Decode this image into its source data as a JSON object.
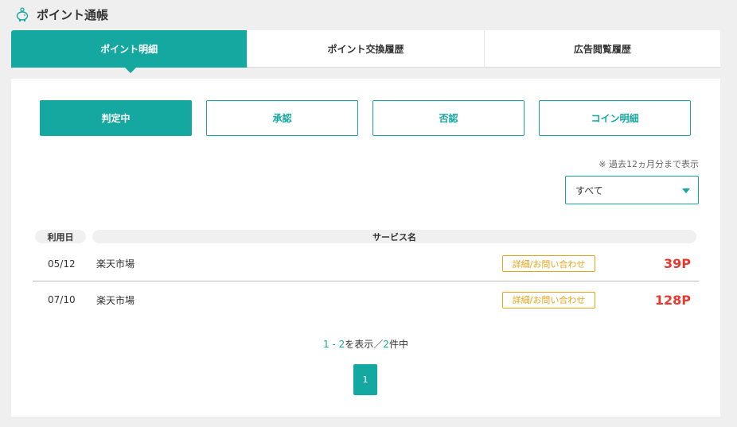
{
  "header": {
    "title": "ポイント通帳",
    "icon": "piggy-bank-icon"
  },
  "main_tabs": [
    {
      "label": "ポイント明細",
      "active": true
    },
    {
      "label": "ポイント交換履歴",
      "active": false
    },
    {
      "label": "広告閲覧履歴",
      "active": false
    }
  ],
  "sub_tabs": [
    {
      "label": "判定中",
      "active": true
    },
    {
      "label": "承認",
      "active": false
    },
    {
      "label": "否認",
      "active": false
    },
    {
      "label": "コイン明細",
      "active": false
    }
  ],
  "note": "※ 過去12ヵ月分まで表示",
  "filter": {
    "selected": "すべて"
  },
  "table": {
    "headers": {
      "date": "利用日",
      "service": "サービス名"
    },
    "rows": [
      {
        "date": "05/12",
        "service": "楽天市場",
        "detail": "詳細/お問い合わせ",
        "points": "39P"
      },
      {
        "date": "07/10",
        "service": "楽天市場",
        "detail": "詳細/お問い合わせ",
        "points": "128P"
      }
    ]
  },
  "summary": {
    "start": "1",
    "sep": " - ",
    "end": "2",
    "mid": "を表示／",
    "total": "2",
    "suffix": "件中"
  },
  "pagination": {
    "current": "1"
  },
  "colors": {
    "accent": "#15a8a0",
    "points": "#e8392f",
    "detail": "#e8a317"
  }
}
